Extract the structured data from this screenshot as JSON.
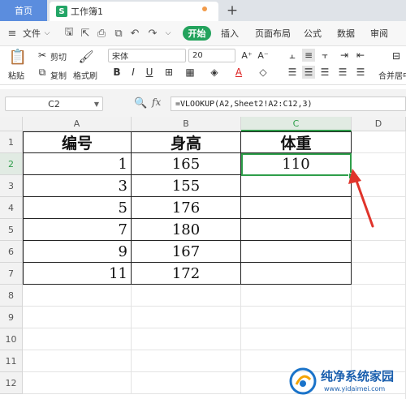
{
  "tabs": {
    "home": "首页",
    "document": "工作簿1",
    "new_tab": "+"
  },
  "menu": {
    "file": "文件",
    "items": [
      "开始",
      "插入",
      "页面布局",
      "公式",
      "数据",
      "审阅"
    ]
  },
  "ribbon": {
    "paste": "粘贴",
    "cut": "剪切",
    "copy": "复制",
    "format_painter": "格式刷",
    "font_name": "宋体",
    "font_size": "20",
    "bold": "B",
    "italic": "I",
    "underline": "U",
    "font_color_letter": "A",
    "merge_center": "合并居中"
  },
  "formula_bar": {
    "cell_ref": "C2",
    "fx": "fx",
    "formula": "=VLOOKUP(A2,Sheet2!A2:C12,3)"
  },
  "sheet": {
    "columns": [
      "A",
      "B",
      "C",
      "D"
    ],
    "rows": [
      "1",
      "2",
      "3",
      "4",
      "5",
      "6",
      "7",
      "8",
      "9",
      "10",
      "11",
      "12"
    ],
    "headers": [
      "编号",
      "身高",
      "体重"
    ],
    "data": [
      [
        "1",
        "165",
        "110"
      ],
      [
        "3",
        "155",
        ""
      ],
      [
        "5",
        "176",
        ""
      ],
      [
        "7",
        "180",
        ""
      ],
      [
        "9",
        "167",
        ""
      ],
      [
        "11",
        "172",
        ""
      ]
    ],
    "selected_cell": "C2"
  },
  "watermark": {
    "title": "纯净系统家园",
    "url": "www.yidaimei.com"
  },
  "colors": {
    "accent_green": "#24a35d",
    "home_tab_blue": "#5b8dde",
    "arrow_red": "#e0342b"
  }
}
